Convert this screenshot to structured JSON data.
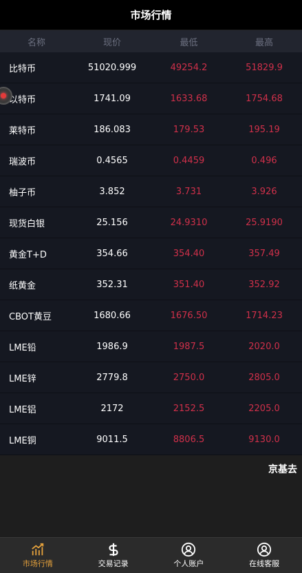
{
  "header": {
    "title": "市场行情"
  },
  "table": {
    "columns": [
      "名称",
      "现价",
      "最低",
      "最高"
    ],
    "rows": [
      {
        "name": "比特币",
        "price": "51020.999",
        "low": "49254.2",
        "high": "51829.9"
      },
      {
        "name": "以特币",
        "price": "1741.09",
        "low": "1633.68",
        "high": "1754.68"
      },
      {
        "name": "莱特币",
        "price": "186.083",
        "low": "179.53",
        "high": "195.19"
      },
      {
        "name": "瑞波币",
        "price": "0.4565",
        "low": "0.4459",
        "high": "0.496"
      },
      {
        "name": "柚子币",
        "price": "3.852",
        "low": "3.731",
        "high": "3.926"
      },
      {
        "name": "现货白银",
        "price": "25.156",
        "low": "24.9310",
        "high": "25.9190"
      },
      {
        "name": "黄金T+D",
        "price": "354.66",
        "low": "354.40",
        "high": "357.49"
      },
      {
        "name": "纸黄金",
        "price": "352.31",
        "low": "351.40",
        "high": "352.92"
      },
      {
        "name": "CBOT黄豆",
        "price": "1680.66",
        "low": "1676.50",
        "high": "1714.23"
      },
      {
        "name": "LME铅",
        "price": "1986.9",
        "low": "1987.5",
        "high": "2020.0"
      },
      {
        "name": "LME锌",
        "price": "2779.8",
        "low": "2750.0",
        "high": "2805.0"
      },
      {
        "name": "LME铝",
        "price": "2172",
        "low": "2152.5",
        "high": "2205.0"
      },
      {
        "name": "LME铜",
        "price": "9011.5",
        "low": "8806.5",
        "high": "9130.0"
      }
    ]
  },
  "marquee": {
    "text": "京基去"
  },
  "tabbar": {
    "items": [
      {
        "label": "市场行情",
        "icon": "chart-icon",
        "active": true
      },
      {
        "label": "交易记录",
        "icon": "dollar-icon",
        "active": false
      },
      {
        "label": "个人账户",
        "icon": "user-icon",
        "active": false
      },
      {
        "label": "在线客服",
        "icon": "support-icon",
        "active": false
      }
    ]
  },
  "colors": {
    "accent": "#e6a23c",
    "down": "#d0304a",
    "background": "#151821"
  }
}
